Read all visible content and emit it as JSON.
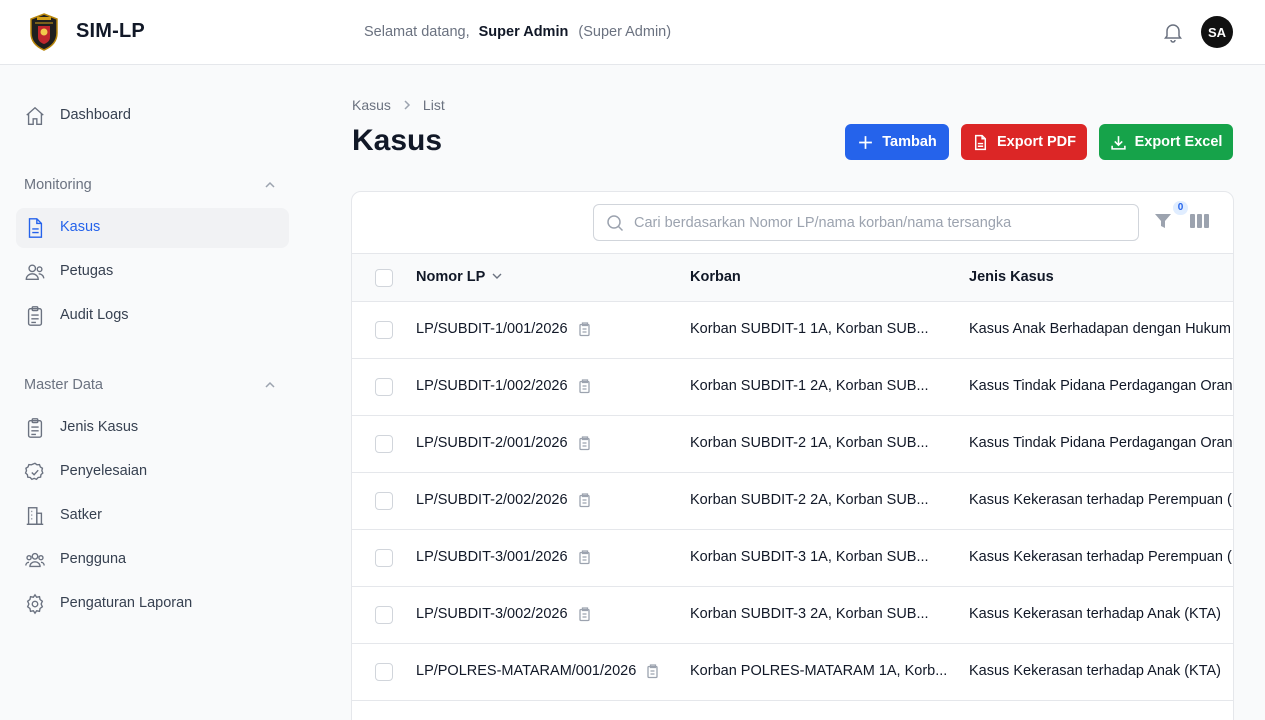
{
  "app": {
    "title": "SIM-LP"
  },
  "header": {
    "welcome_prefix": "Selamat datang,",
    "user_name": "Super Admin",
    "user_role": "(Super Admin)",
    "avatar_initials": "SA"
  },
  "sidebar": {
    "dashboard": {
      "label": "Dashboard",
      "icon": "home-icon"
    },
    "monitoring": {
      "label": "Monitoring",
      "items": [
        {
          "label": "Kasus",
          "icon": "document-icon",
          "active": true
        },
        {
          "label": "Petugas",
          "icon": "users-icon"
        },
        {
          "label": "Audit Logs",
          "icon": "clipboard-icon"
        }
      ]
    },
    "master_data": {
      "label": "Master Data",
      "items": [
        {
          "label": "Jenis Kasus",
          "icon": "clipboard-icon"
        },
        {
          "label": "Penyelesaian",
          "icon": "check-circle-icon"
        },
        {
          "label": "Satker",
          "icon": "building-icon"
        },
        {
          "label": "Pengguna",
          "icon": "user-group-icon"
        },
        {
          "label": "Pengaturan Laporan",
          "icon": "gear-icon"
        }
      ]
    }
  },
  "breadcrumb": {
    "parent": "Kasus",
    "current": "List"
  },
  "page": {
    "title": "Kasus"
  },
  "actions": {
    "add": "Tambah",
    "export_pdf": "Export PDF",
    "export_excel": "Export Excel"
  },
  "colors": {
    "primary": "#2563eb",
    "danger": "#dc2626",
    "success": "#16a34a"
  },
  "table": {
    "search_placeholder": "Cari berdasarkan Nomor LP/nama korban/nama tersangka",
    "filter_count": "0",
    "columns": {
      "nomor_lp": "Nomor LP",
      "korban": "Korban",
      "jenis_kasus": "Jenis Kasus"
    },
    "rows": [
      {
        "nomor_lp": "LP/SUBDIT-1/001/2026",
        "korban": "Korban SUBDIT-1 1A, Korban SUB...",
        "jenis_kasus": "Kasus Anak Berhadapan dengan Hukum"
      },
      {
        "nomor_lp": "LP/SUBDIT-1/002/2026",
        "korban": "Korban SUBDIT-1 2A, Korban SUB...",
        "jenis_kasus": "Kasus Tindak Pidana Perdagangan Orang"
      },
      {
        "nomor_lp": "LP/SUBDIT-2/001/2026",
        "korban": "Korban SUBDIT-2 1A, Korban SUB...",
        "jenis_kasus": "Kasus Tindak Pidana Perdagangan Orang"
      },
      {
        "nomor_lp": "LP/SUBDIT-2/002/2026",
        "korban": "Korban SUBDIT-2 2A, Korban SUB...",
        "jenis_kasus": "Kasus Kekerasan terhadap Perempuan ("
      },
      {
        "nomor_lp": "LP/SUBDIT-3/001/2026",
        "korban": "Korban SUBDIT-3 1A, Korban SUB...",
        "jenis_kasus": "Kasus Kekerasan terhadap Perempuan ("
      },
      {
        "nomor_lp": "LP/SUBDIT-3/002/2026",
        "korban": "Korban SUBDIT-3 2A, Korban SUB...",
        "jenis_kasus": "Kasus Kekerasan terhadap Anak (KTA)"
      },
      {
        "nomor_lp": "LP/POLRES-MATARAM/001/2026",
        "korban": "Korban POLRES-MATARAM 1A, Korb...",
        "jenis_kasus": "Kasus Kekerasan terhadap Anak (KTA)"
      }
    ]
  }
}
